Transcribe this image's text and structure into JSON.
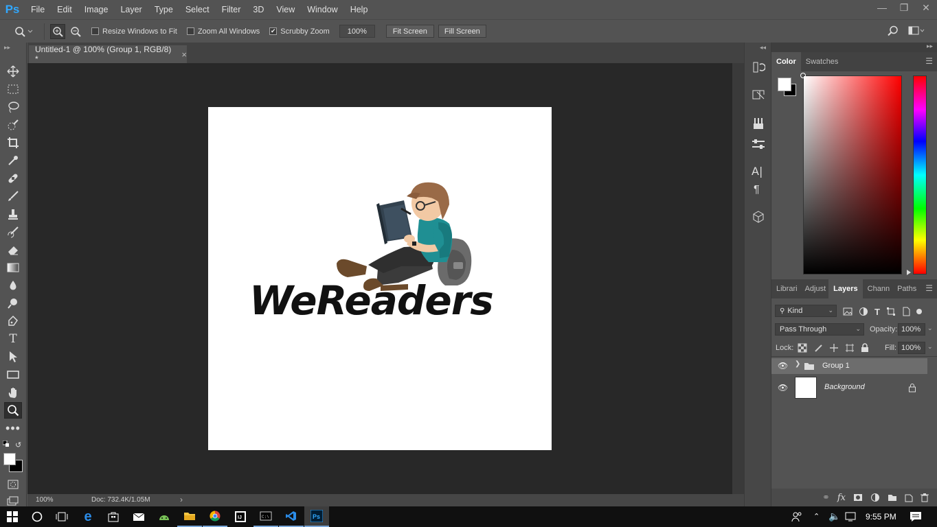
{
  "app": {
    "logo": "Ps"
  },
  "menu": {
    "items": [
      "File",
      "Edit",
      "Image",
      "Layer",
      "Type",
      "Select",
      "Filter",
      "3D",
      "View",
      "Window",
      "Help"
    ]
  },
  "options": {
    "resize_windows": {
      "label": "Resize Windows to Fit",
      "checked": false
    },
    "zoom_all": {
      "label": "Zoom All Windows",
      "checked": false
    },
    "scrubby": {
      "label": "Scrubby Zoom",
      "checked": true
    },
    "zoom_value": "100%",
    "fit_screen": "Fit Screen",
    "fill_screen": "Fill Screen"
  },
  "document": {
    "tab_title": "Untitled-1 @ 100% (Group 1, RGB/8) *",
    "close_glyph": "×",
    "canvas_text": "WeReaders"
  },
  "status": {
    "zoom": "100%",
    "doc": "Doc: 732.4K/1.05M"
  },
  "color_panel": {
    "tabs": [
      "Color",
      "Swatches"
    ],
    "active": "Color",
    "foreground": "#ffffff",
    "background": "#000000"
  },
  "layers_panel": {
    "tabs": [
      "Librari",
      "Adjust",
      "Layers",
      "Chann",
      "Paths"
    ],
    "active": "Layers",
    "filter_kind": "Kind",
    "blend_mode": "Pass Through",
    "opacity_label": "Opacity:",
    "opacity": "100%",
    "lock_label": "Lock:",
    "fill_label": "Fill:",
    "fill": "100%",
    "layers": [
      {
        "name": "Group 1",
        "type": "group",
        "visible": true,
        "selected": true
      },
      {
        "name": "Background",
        "type": "background",
        "visible": true,
        "locked": true
      }
    ]
  },
  "taskbar": {
    "time": "9:55 PM"
  }
}
